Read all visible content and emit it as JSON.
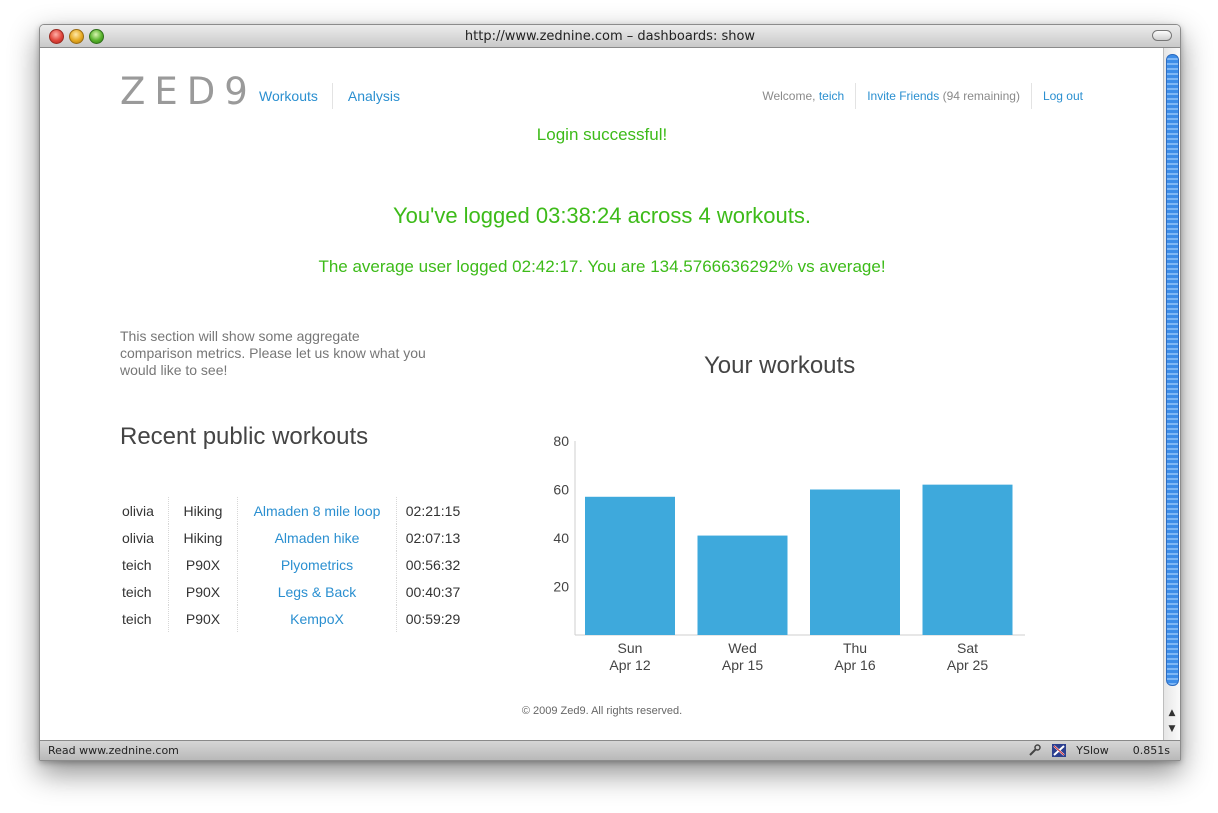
{
  "window": {
    "title": "http://www.zednine.com – dashboards: show",
    "status": "Read www.zednine.com",
    "yslow_label": "YSlow",
    "load_time": "0.851s"
  },
  "brand": {
    "logo": "ZED9"
  },
  "nav": {
    "workouts": "Workouts",
    "analysis": "Analysis"
  },
  "user": {
    "welcome_prefix": "Welcome,",
    "username": "teich",
    "invite": "Invite Friends",
    "invite_remaining": "(94 remaining)",
    "logout": "Log out"
  },
  "flash": "Login successful!",
  "summary": {
    "headline": "You've logged 03:38:24 across 4 workouts.",
    "average": "The average user logged 02:42:17. You are 134.5766636292% vs average!"
  },
  "intro": "This section will show some aggregate comparison metrics. Please let us know what you would like to see!",
  "recent": {
    "title": "Recent public workouts",
    "rows": [
      {
        "user": "olivia",
        "type": "Hiking",
        "name": "Almaden 8 mile loop",
        "time": "02:21:15"
      },
      {
        "user": "olivia",
        "type": "Hiking",
        "name": "Almaden hike",
        "time": "02:07:13"
      },
      {
        "user": "teich",
        "type": "P90X",
        "name": "Plyometrics",
        "time": "00:56:32"
      },
      {
        "user": "teich",
        "type": "P90X",
        "name": "Legs & Back",
        "time": "00:40:37"
      },
      {
        "user": "teich",
        "type": "P90X",
        "name": "KempoX",
        "time": "00:59:29"
      }
    ]
  },
  "chart_title": "Your workouts",
  "chart_data": {
    "type": "bar",
    "categories": [
      [
        "Sun",
        "Apr 12"
      ],
      [
        "Wed",
        "Apr 15"
      ],
      [
        "Thu",
        "Apr 16"
      ],
      [
        "Sat",
        "Apr 25"
      ]
    ],
    "values": [
      57,
      41,
      60,
      62
    ],
    "ylim": [
      0,
      80
    ],
    "yticks": [
      20,
      40,
      60,
      80
    ],
    "title": "Your workouts",
    "xlabel": "",
    "ylabel": "",
    "color": "#3ea9dc",
    "grid": false
  },
  "footer": "© 2009 Zed9. All rights reserved."
}
